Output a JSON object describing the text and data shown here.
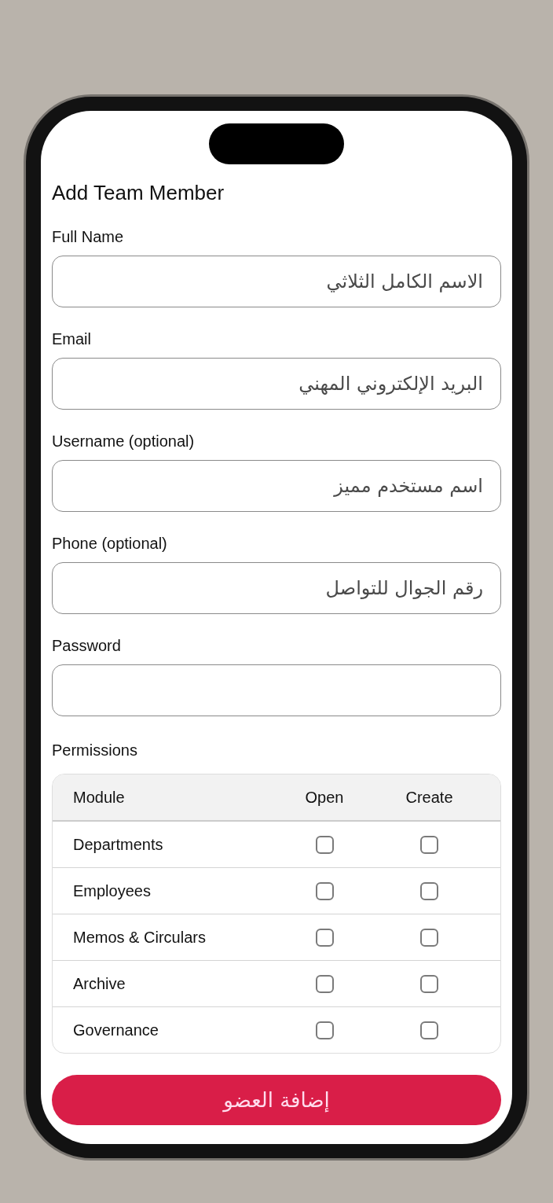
{
  "title": "Add Team Member",
  "fields": [
    {
      "label": "Full Name",
      "placeholder": "الاسم الكامل الثلاثي"
    },
    {
      "label": "Email",
      "placeholder": "البريد الإلكتروني المهني"
    },
    {
      "label": "Username (optional)",
      "placeholder": "اسم مستخدم مميز"
    },
    {
      "label": "Phone (optional)",
      "placeholder": "رقم الجوال للتواصل"
    },
    {
      "label": "Password"
    }
  ],
  "permissions": {
    "label": "Permissions",
    "columns": [
      "Module",
      "Open",
      "Create"
    ],
    "rows": [
      {
        "module": "Departments",
        "open": false,
        "create": false
      },
      {
        "module": "Employees",
        "open": false,
        "create": false
      },
      {
        "module": "Memos & Circulars",
        "open": false,
        "create": false
      },
      {
        "module": "Archive",
        "open": false,
        "create": false
      },
      {
        "module": "Governance",
        "open": false,
        "create": false
      }
    ]
  },
  "submit": "إضافة العضو"
}
